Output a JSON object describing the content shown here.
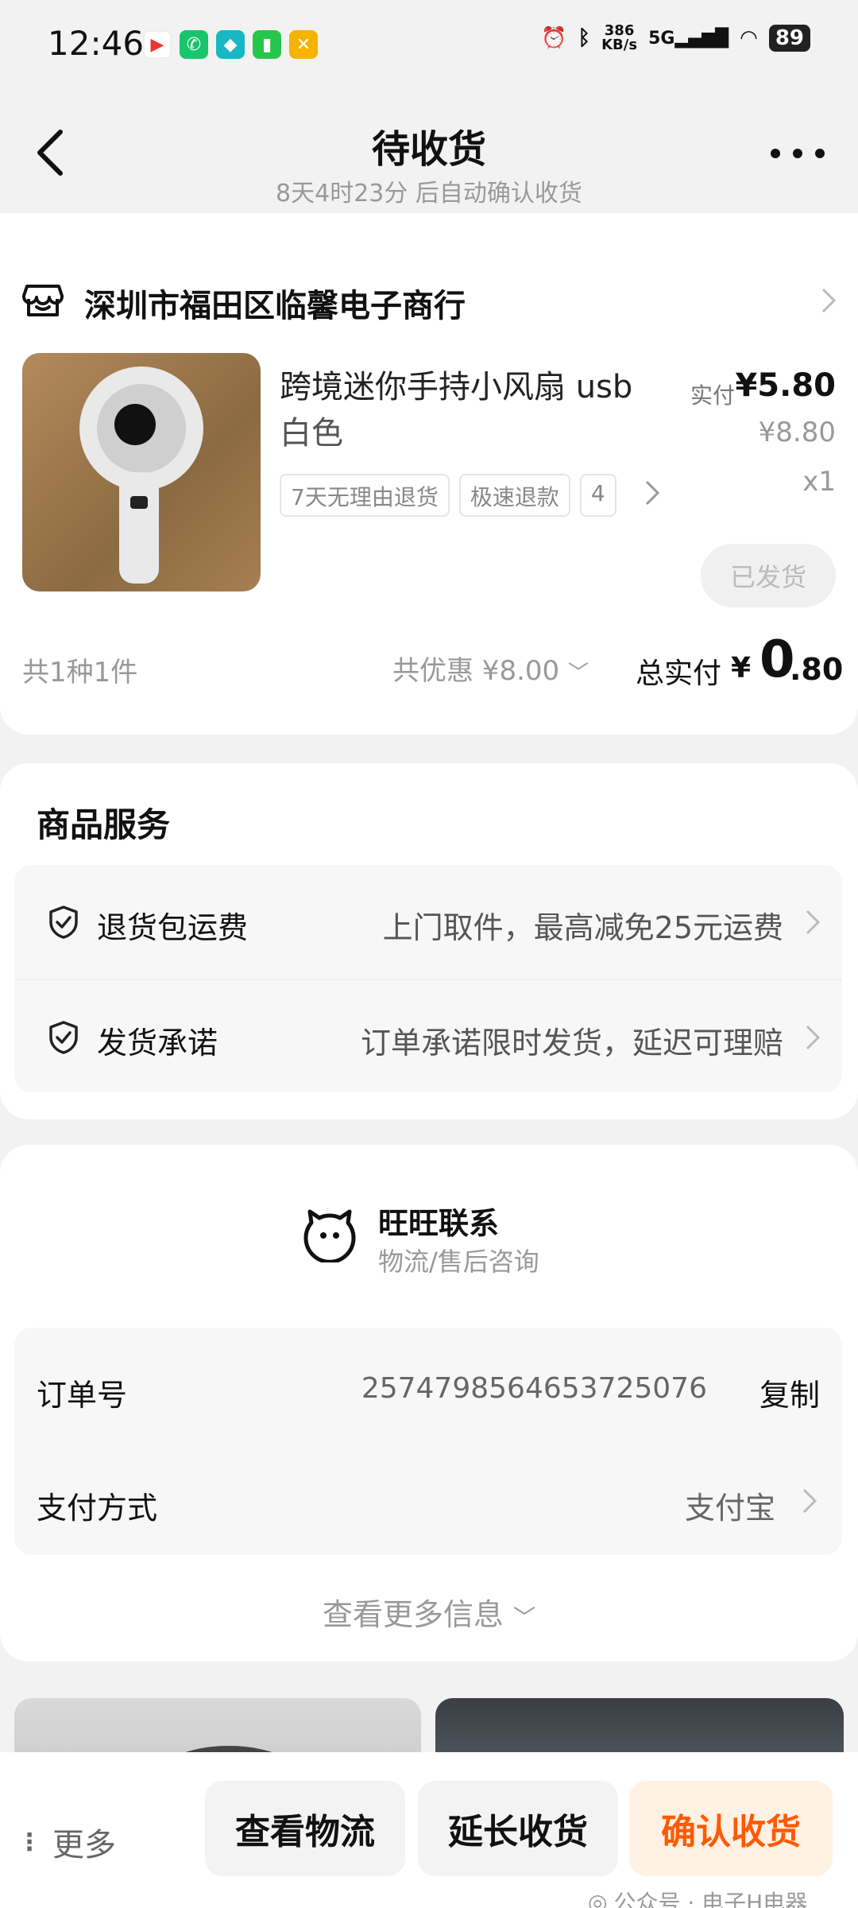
{
  "status_bar": {
    "time": "12:46",
    "net_speed_value": "386",
    "net_speed_unit": "KB/s",
    "network": "5G",
    "battery": "89"
  },
  "header": {
    "title": "待收货",
    "subtitle": "8天4时23分 后自动确认收货"
  },
  "order": {
    "store_name": "深圳市福田区临馨电子商行",
    "product_name": "跨境迷你手持小风扇 usb",
    "variant": "白色",
    "paid_label": "实付",
    "paid_price": "¥5.80",
    "original_price": "¥8.80",
    "quantity": "x1",
    "tags": [
      "7天无理由退货",
      "极速退款",
      "4"
    ],
    "status_button": "已发货",
    "count_text": "共1种1件",
    "discount_text": "共优惠 ¥8.00",
    "total_label": "总实付",
    "total_currency": "¥",
    "total_integer": "0",
    "total_decimal": ".80"
  },
  "services": {
    "title": "商品服务",
    "items": [
      {
        "name": "退货包运费",
        "desc": "上门取件，最高减免25元运费"
      },
      {
        "name": "发货承诺",
        "desc": "订单承诺限时发货，延迟可理赔"
      }
    ]
  },
  "contact": {
    "title": "旺旺联系",
    "subtitle": "物流/售后咨询",
    "order_no_label": "订单号",
    "order_no": "2574798564653725076",
    "copy": "复制",
    "pay_label": "支付方式",
    "pay_value": "支付宝",
    "more_info": "查看更多信息"
  },
  "bottom_bar": {
    "more": "更多",
    "view_logistics": "查看物流",
    "extend": "延长收货",
    "confirm": "确认收货",
    "watermark": "公众号 · 电子H电器"
  },
  "colors": {
    "accent": "#ff5a00",
    "accent_bg": "#fff1e4",
    "background": "#f2f2f2"
  }
}
